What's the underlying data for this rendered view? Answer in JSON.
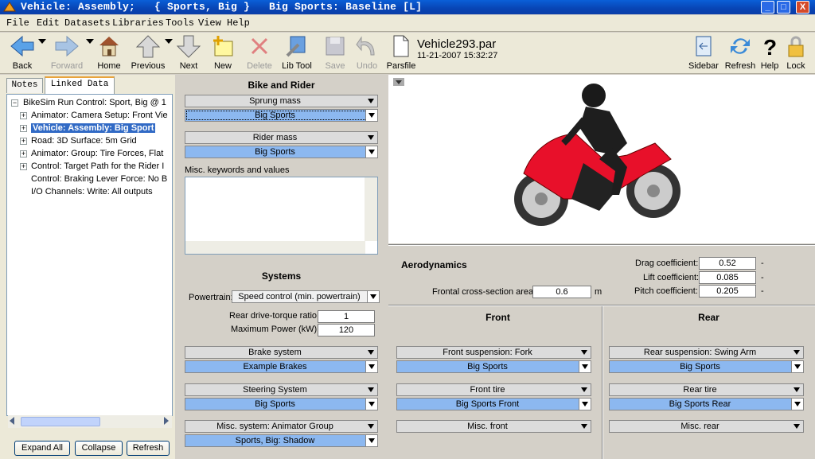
{
  "window": {
    "title": "Vehicle: Assembly;   { Sports, Big }   Big Sports: Baseline [L]",
    "buttons": {
      "minimize": "_",
      "maximize": "□",
      "close": "X"
    }
  },
  "menu": [
    "File",
    "Edit",
    "Datasets",
    "Libraries",
    "Tools",
    "View",
    "Help"
  ],
  "toolbar": {
    "back": "Back",
    "forward": "Forward",
    "home": "Home",
    "previous": "Previous",
    "next": "Next",
    "new": "New",
    "delete": "Delete",
    "libtool": "Lib Tool",
    "save": "Save",
    "undo": "Undo",
    "parsfile": "Parsfile",
    "sidebar": "Sidebar",
    "refresh": "Refresh",
    "help": "Help",
    "lock": "Lock"
  },
  "parsfile": {
    "name": "Vehicle293.par",
    "date": "11-21-2007 15:32:27"
  },
  "left": {
    "tabs": [
      "Notes",
      "Linked Data"
    ],
    "tree": [
      "BikeSim Run Control: Sport, Big @ 1",
      "Animator: Camera Setup: Front Vie",
      "Vehicle: Assembly: Big Sport",
      "Road: 3D Surface: 5m Grid",
      "Animator: Group: Tire Forces, Flat",
      "Control: Target Path for the Rider I",
      "Control: Braking Lever Force: No B",
      "I/O Channels: Write: All outputs"
    ],
    "buttons": {
      "expand": "Expand All",
      "collapse": "Collapse",
      "refresh": "Refresh"
    }
  },
  "bike_rider": {
    "header": "Bike and Rider",
    "sprung_mass_label": "Sprung mass",
    "sprung_mass_value": "Big Sports",
    "rider_mass_label": "Rider mass",
    "rider_mass_value": "Big Sports",
    "misc_label": "Misc. keywords and values"
  },
  "systems": {
    "header": "Systems",
    "powertrain_label": "Powertrain:",
    "powertrain_value": "Speed control (min. powertrain)",
    "ratio_label": "Rear drive-torque ratio:",
    "ratio_value": "1",
    "power_label": "Maximum Power (kW):",
    "power_value": "120",
    "brake_label": "Brake system",
    "brake_value": "Example Brakes",
    "steering_label": "Steering System",
    "steering_value": "Big Sports",
    "misc_label": "Misc. system: Animator Group",
    "misc_value": "Sports, Big: Shadow"
  },
  "aero": {
    "header": "Aerodynamics",
    "frontal_label": "Frontal cross-section area:",
    "frontal_value": "0.6",
    "frontal_unit": "m",
    "drag_label": "Drag coefficient:",
    "drag_value": "0.52",
    "lift_label": "Lift coefficient:",
    "lift_value": "0.085",
    "pitch_label": "Pitch coefficient:",
    "pitch_value": "0.205",
    "unit_dash": "-"
  },
  "front": {
    "header": "Front",
    "susp_label": "Front suspension: Fork",
    "susp_value": "Big Sports",
    "tire_label": "Front tire",
    "tire_value": "Big Sports Front",
    "misc_label": "Misc. front"
  },
  "rear": {
    "header": "Rear",
    "susp_label": "Rear  suspension: Swing Arm",
    "susp_value": "Big Sports",
    "tire_label": "Rear tire",
    "tire_value": "Big Sports Rear",
    "misc_label": "Misc. rear"
  },
  "colors": {
    "selected_combo": "#8cb8f0",
    "title_bar": "#0a5fd8",
    "bike_body": "#e8102a"
  }
}
